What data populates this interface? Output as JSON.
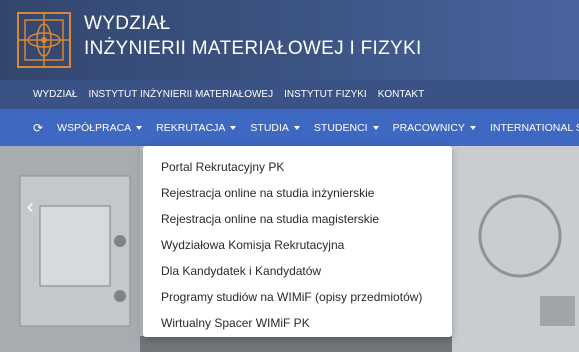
{
  "header": {
    "title_line1": "WYDZIAŁ",
    "title_line2": "INŻYNIERII MATERIAŁOWEJ I FIZYKI",
    "logo_icon": "faculty-logo-icon"
  },
  "topnav": {
    "items": [
      "WYDZIAŁ",
      "INSTYTUT INŻYNIERII MATERIAŁOWEJ",
      "INSTYTUT FIZYKI",
      "KONTAKT"
    ]
  },
  "mainnav": {
    "refresh_icon": "refresh-icon",
    "items": [
      "WSPÓŁPRACA",
      "REKRUTACJA",
      "STUDIA",
      "STUDENCI",
      "PRACOWNICY",
      "INTERNATIONAL STUDE"
    ]
  },
  "dropdown": {
    "items": [
      "Portal Rekrutacyjny PK",
      "Rejestracja online na studia inżynierskie",
      "Rejestracja online na studia magisterskie",
      "Wydziałowa Komisja Rekrutacyjna",
      "Dla Kandydatek i Kandydatów",
      "Programy studiów na WIMiF (opisy przedmiotów)",
      "Wirtualny Spacer WIMiF PK"
    ]
  },
  "hero": {
    "prev_icon": "chevron-left-icon"
  },
  "colors": {
    "header": "#33466f",
    "topnav": "#3a5286",
    "mainnav": "#3f68c2",
    "dropdown_bg": "#ffffff"
  }
}
